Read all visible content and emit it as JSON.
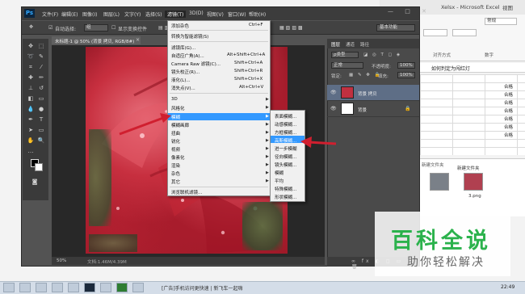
{
  "excel": {
    "title": "Xelsx - Microsoft Excel",
    "view_tab": "视图",
    "font_box": "常规",
    "alignment_label": "对齐方式",
    "number_label": "数字",
    "formula": "如何判定为闯红灯",
    "cells": [
      "合格",
      "合格",
      "合格",
      "合格",
      "合格",
      "合格",
      "合格"
    ],
    "files_header": "新建文件夹",
    "file_names": [
      "新建文件夹",
      "3.png"
    ]
  },
  "photoshop": {
    "logo": "Ps",
    "menus": [
      "文件(F)",
      "编辑(E)",
      "图像(I)",
      "图层(L)",
      "文字(Y)",
      "选择(S)",
      "滤镜(T)",
      "3D(D)",
      "视图(V)",
      "窗口(W)",
      "帮助(H)"
    ],
    "active_menu": "滤镜(T)",
    "window_buttons": "— □ ✕",
    "options": {
      "auto_select": "自动选择:",
      "auto_select_value": "组",
      "show_transform": "显示变换控件",
      "workspace": "基本功能"
    },
    "document_tab": "未标题-1 @ 50% (背景 拷贝, RGB/8#)",
    "status_zoom": "50%",
    "status_doc": "文档:1.46M/4.39M",
    "layers": {
      "tabs": [
        "图层",
        "通道",
        "路径"
      ],
      "kind_filter": "ρ类型",
      "blend_mode": "正常",
      "opacity_label": "不透明度:",
      "opacity": "100%",
      "lock_label": "锁定:",
      "fill_label": "填充:",
      "fill": "100%",
      "items": [
        {
          "name": "背景 拷贝",
          "selected": true
        },
        {
          "name": "背景",
          "selected": false
        }
      ],
      "footer_icons": "∞ fx ◐ ◻ ▭ ⊞ 🗑"
    }
  },
  "filter_menu": {
    "items": [
      {
        "label": "添加杂色",
        "shortcut": "Ctrl+F",
        "submenu": false
      },
      {
        "label": "转换为智能滤镜(S)",
        "shortcut": "",
        "submenu": false
      },
      {
        "label": "滤镜库(G)...",
        "shortcut": "",
        "submenu": false
      },
      {
        "label": "自适应广角(A)...",
        "shortcut": "Alt+Shift+Ctrl+A",
        "submenu": false
      },
      {
        "label": "Camera Raw 滤镜(C)...",
        "shortcut": "Shift+Ctrl+A",
        "submenu": false
      },
      {
        "label": "镜头校正(R)...",
        "shortcut": "Shift+Ctrl+R",
        "submenu": false
      },
      {
        "label": "液化(L)...",
        "shortcut": "Shift+Ctrl+X",
        "submenu": false
      },
      {
        "label": "消失点(V)...",
        "shortcut": "Alt+Ctrl+V",
        "submenu": false
      },
      {
        "label": "3D",
        "shortcut": "",
        "submenu": true
      },
      {
        "label": "风格化",
        "shortcut": "",
        "submenu": true
      },
      {
        "label": "模糊",
        "shortcut": "",
        "submenu": true
      },
      {
        "label": "模糊画廊",
        "shortcut": "",
        "submenu": true
      },
      {
        "label": "扭曲",
        "shortcut": "",
        "submenu": true
      },
      {
        "label": "锐化",
        "shortcut": "",
        "submenu": true
      },
      {
        "label": "视频",
        "shortcut": "",
        "submenu": true
      },
      {
        "label": "像素化",
        "shortcut": "",
        "submenu": true
      },
      {
        "label": "渲染",
        "shortcut": "",
        "submenu": true
      },
      {
        "label": "杂色",
        "shortcut": "",
        "submenu": true
      },
      {
        "label": "其它",
        "shortcut": "",
        "submenu": true
      },
      {
        "label": "浏览联机滤镜...",
        "shortcut": "",
        "submenu": false
      }
    ],
    "highlighted": "模糊"
  },
  "blur_menu": {
    "items": [
      "表面模糊...",
      "动感模糊...",
      "方框模糊...",
      "高斯模糊...",
      "进一步模糊",
      "径向模糊...",
      "镜头模糊...",
      "模糊",
      "平均",
      "特殊模糊...",
      "形状模糊..."
    ],
    "highlighted": "高斯模糊..."
  },
  "taskbar": {
    "message": "[广告]手机访问更快速 | 新飞车一起嗨",
    "clock": "22:49"
  },
  "watermark": {
    "title": "百科全说",
    "subtitle": "助你轻松解决"
  },
  "colors": {
    "ps_bg": "#535353",
    "menu_highlight": "#3399ff",
    "annotation_arrow": "#d01f2f",
    "watermark_green": "#2bb24c"
  }
}
